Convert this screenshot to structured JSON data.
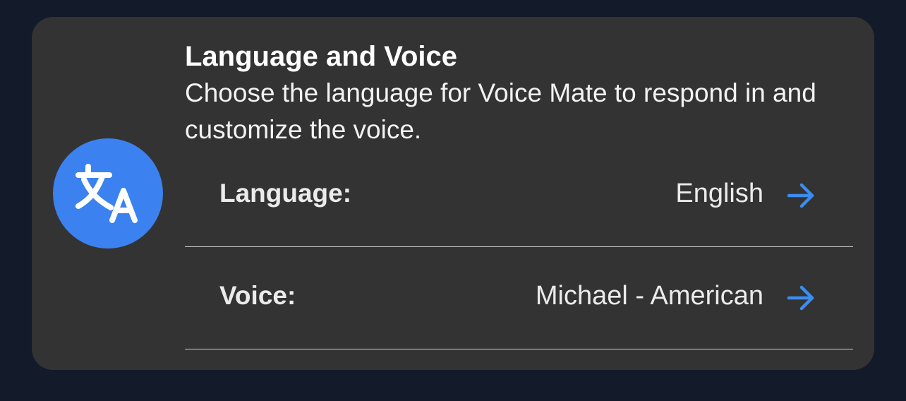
{
  "card": {
    "title": "Language and Voice",
    "description": "Choose the language for Voice Mate to respond in and customize the voice.",
    "icon": "translate-icon",
    "accent_color": "#3b82f0"
  },
  "settings": [
    {
      "label": "Language:",
      "value": "English",
      "icon": "arrow-right-icon"
    },
    {
      "label": "Voice:",
      "value": "Michael - American",
      "icon": "arrow-right-icon"
    }
  ]
}
